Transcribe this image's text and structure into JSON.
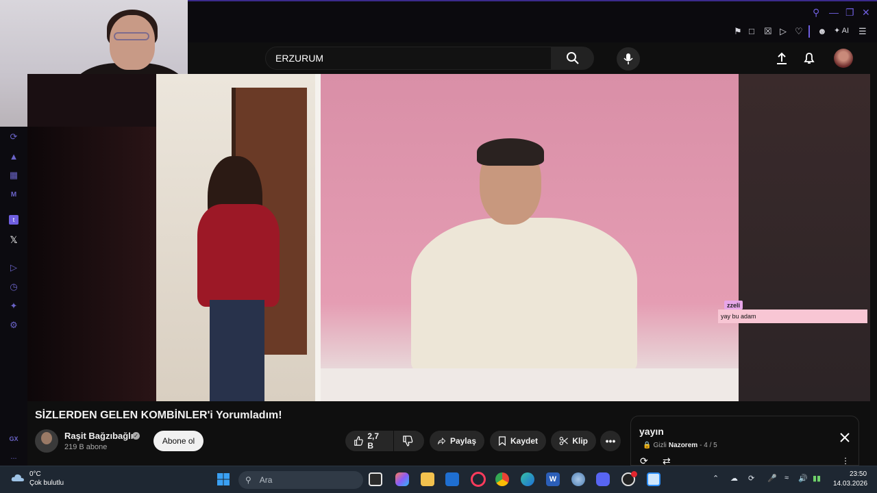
{
  "browser": {
    "search_query": "ERZURUM",
    "ai_label": "AI",
    "gx_label": "GX",
    "more_label": "..."
  },
  "video": {
    "title": "SİZLERDEN GELEN KOMBİNLER'i Yorumladım!",
    "chat_user": "zzeli",
    "chat_message": "yay bu adam"
  },
  "channel": {
    "name": "Raşit Bağzıbağlı",
    "subscribers": "219 B abone",
    "subscribe_label": "Abone ol"
  },
  "actions": {
    "likes": "2,7 B",
    "share_label": "Paylaş",
    "save_label": "Kaydet",
    "clip_label": "Klip"
  },
  "playlist": {
    "title": "yayın",
    "privacy": "Gizli",
    "owner": "Nazorem",
    "position": "- 4 / 5"
  },
  "taskbar": {
    "temperature": "0°C",
    "weather": "Çok bulutlu",
    "search_placeholder": "Ara",
    "time": "23:50",
    "date": "14.03.2026"
  },
  "colors": {
    "accent_gx": "#6f5fe0",
    "yt_bg": "#0f0f0f",
    "pill_bg": "#272727"
  }
}
